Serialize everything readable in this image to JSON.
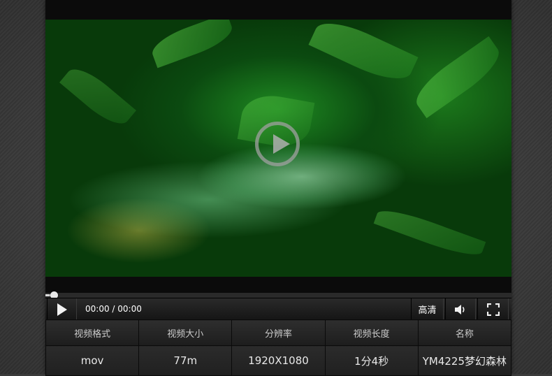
{
  "player": {
    "time_display": "00:00 / 00:00",
    "progress": 0,
    "quality_label": "高清"
  },
  "icons": {
    "overlay": "play-circle-icon",
    "play": "play-icon",
    "volume": "speaker-icon",
    "fullscreen": "fullscreen-icon"
  },
  "info": {
    "headers": [
      "视频格式",
      "视频大小",
      "分辨率",
      "视频长度",
      "名称"
    ],
    "values": [
      "mov",
      "77m",
      "1920X1080",
      "1分4秒",
      "YM4225梦幻森林"
    ]
  },
  "colors": {
    "background": "#3a3a3a",
    "player_bg": "#0b0b0b",
    "video_green": "#1f8a22"
  }
}
